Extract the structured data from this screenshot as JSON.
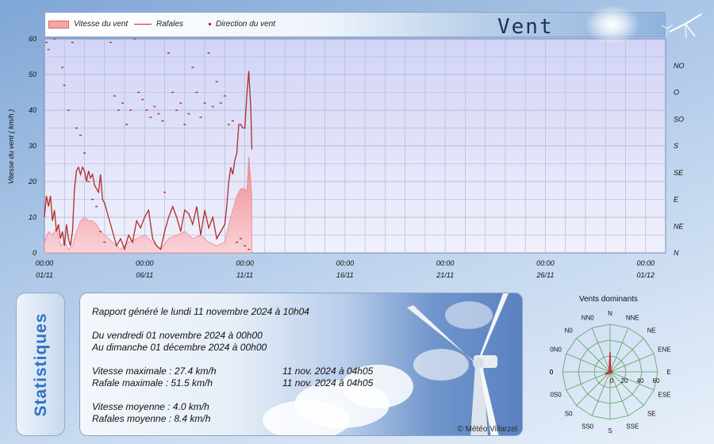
{
  "header": {
    "title": "Vent",
    "legend": {
      "speed_label": "Vitesse du vent",
      "gust_label": "Rafales",
      "direction_label": "Direction du vent"
    }
  },
  "colors": {
    "speed_fill": "#f3a7a7",
    "gust_line": "#b22b2b",
    "plot_bg_top": "#d4d6f7",
    "plot_bg_bottom": "#eef0fb",
    "rose_grid": "#59a05b",
    "rose_series": "#c0303a",
    "stat_label": "#2f72c2"
  },
  "chart_data": {
    "type": "line",
    "ylabel": "Vitesse du vent ( km/h )",
    "ylim": [
      0,
      60
    ],
    "yticks": [
      "0",
      "10",
      "20",
      "30",
      "40",
      "50",
      "60"
    ],
    "y2ticks": [
      "N",
      "NE",
      "E",
      "SE",
      "S",
      "SO",
      "O",
      "NO"
    ],
    "x_range_days": [
      1,
      32
    ],
    "xticks": [
      {
        "time": "00:00",
        "date": "01/11"
      },
      {
        "time": "00:00",
        "date": "06/11"
      },
      {
        "time": "00:00",
        "date": "11/11"
      },
      {
        "time": "00:00",
        "date": "16/11"
      },
      {
        "time": "00:00",
        "date": "21/11"
      },
      {
        "time": "00:00",
        "date": "26/11"
      },
      {
        "time": "00:00",
        "date": "01/12"
      }
    ],
    "grid": true,
    "legend_position": "top",
    "series": [
      {
        "name": "Rafales",
        "x": [
          1.0,
          1.1,
          1.2,
          1.3,
          1.4,
          1.5,
          1.6,
          1.7,
          1.8,
          1.9,
          2.0,
          2.1,
          2.2,
          2.3,
          2.4,
          2.5,
          2.6,
          2.7,
          2.8,
          2.9,
          3.0,
          3.1,
          3.2,
          3.3,
          3.4,
          3.5,
          3.6,
          3.7,
          3.8,
          3.9,
          4.0,
          4.2,
          4.4,
          4.6,
          4.8,
          5.0,
          5.2,
          5.4,
          5.6,
          5.8,
          6.0,
          6.2,
          6.4,
          6.6,
          6.8,
          7.0,
          7.2,
          7.4,
          7.6,
          7.8,
          8.0,
          8.2,
          8.4,
          8.6,
          8.8,
          9.0,
          9.2,
          9.4,
          9.6,
          9.8,
          10.0,
          10.1,
          10.2,
          10.3,
          10.4,
          10.5,
          10.6,
          10.7,
          10.8,
          10.9,
          11.0,
          11.1,
          11.2,
          11.3,
          11.35
        ],
        "values": [
          10,
          16,
          13,
          16,
          9,
          12,
          6,
          8,
          4,
          6,
          2,
          8,
          4,
          2,
          6,
          18,
          23,
          24,
          22,
          24,
          23,
          20,
          23,
          21,
          22,
          19,
          18,
          17,
          22,
          15,
          14,
          10,
          6,
          2,
          4,
          1,
          5,
          3,
          9,
          7,
          10,
          12,
          4,
          2,
          1,
          6,
          10,
          13,
          10,
          6,
          12,
          11,
          8,
          13,
          5,
          12,
          7,
          10,
          4,
          6,
          8,
          13,
          20,
          24,
          22,
          26,
          28,
          36,
          36,
          35,
          35,
          44,
          51,
          40,
          29
        ]
      },
      {
        "name": "Vitesse du vent",
        "x": [
          1.0,
          1.2,
          1.4,
          1.6,
          1.8,
          2.0,
          2.2,
          2.4,
          2.6,
          2.8,
          3.0,
          3.2,
          3.4,
          3.6,
          3.8,
          4.0,
          4.4,
          4.8,
          5.2,
          5.6,
          6.0,
          6.4,
          6.8,
          7.2,
          7.6,
          8.0,
          8.4,
          8.8,
          9.2,
          9.6,
          10.0,
          10.2,
          10.4,
          10.6,
          10.8,
          11.0,
          11.1,
          11.2,
          11.3,
          11.35
        ],
        "values": [
          3,
          6,
          5,
          7,
          2,
          3,
          1,
          2,
          6,
          9,
          10,
          9,
          9,
          8,
          6,
          5,
          3,
          1,
          3,
          4,
          5,
          3,
          1,
          4,
          5,
          6,
          4,
          5,
          3,
          2,
          3,
          8,
          12,
          16,
          18,
          18,
          17,
          27,
          20,
          16
        ]
      },
      {
        "name": "Direction du vent",
        "points": [
          [
            1.1,
            59
          ],
          [
            1.2,
            57
          ],
          [
            1.5,
            60
          ],
          [
            1.9,
            52
          ],
          [
            2.0,
            47
          ],
          [
            2.2,
            40
          ],
          [
            2.4,
            59
          ],
          [
            2.6,
            35
          ],
          [
            2.8,
            33
          ],
          [
            3.0,
            28
          ],
          [
            3.2,
            20
          ],
          [
            3.4,
            15
          ],
          [
            3.6,
            13
          ],
          [
            3.8,
            6
          ],
          [
            4.0,
            3
          ],
          [
            4.3,
            59
          ],
          [
            4.5,
            44
          ],
          [
            4.7,
            40
          ],
          [
            4.9,
            42
          ],
          [
            5.1,
            36
          ],
          [
            5.3,
            40
          ],
          [
            5.5,
            60
          ],
          [
            5.7,
            45
          ],
          [
            5.9,
            43
          ],
          [
            6.1,
            40
          ],
          [
            6.3,
            38
          ],
          [
            6.5,
            41
          ],
          [
            6.7,
            39
          ],
          [
            6.9,
            37
          ],
          [
            7.0,
            17
          ],
          [
            7.2,
            56
          ],
          [
            7.4,
            45
          ],
          [
            7.6,
            40
          ],
          [
            7.8,
            42
          ],
          [
            8.0,
            36
          ],
          [
            8.2,
            39
          ],
          [
            8.4,
            52
          ],
          [
            8.6,
            45
          ],
          [
            8.8,
            38
          ],
          [
            9.0,
            42
          ],
          [
            9.2,
            56
          ],
          [
            9.4,
            41
          ],
          [
            9.6,
            48
          ],
          [
            9.8,
            42
          ],
          [
            10.0,
            44
          ],
          [
            10.2,
            36
          ],
          [
            10.4,
            37
          ],
          [
            10.6,
            3
          ],
          [
            10.8,
            4
          ],
          [
            11.0,
            2
          ],
          [
            11.2,
            1
          ]
        ]
      }
    ]
  },
  "stats": {
    "tab_label": "Statistiques",
    "generated": "Rapport généré le lundi 11 novembre 2024 à 10h04",
    "period_from": "Du vendredi 01 novembre 2024 à 00h00",
    "period_to": "Au dimanche 01 décembre 2024 à 00h00",
    "max_speed": "Vitesse maximale : 27.4 km/h",
    "max_speed_date": "11 nov. 2024 à 04h05",
    "max_gust": "Rafale maximale : 51.5 km/h",
    "max_gust_date": "11 nov. 2024 à 04h05",
    "avg_speed": "Vitesse moyenne : 4.0 km/h",
    "avg_gust": "Rafales moyenne : 8.4 km/h",
    "copyright": "© Météo Villarzel"
  },
  "rose": {
    "title": "Vents dominants",
    "directions": [
      "N",
      "NNE",
      "NE",
      "ENE",
      "E",
      "ESE",
      "SE",
      "SSE",
      "S",
      "SS0",
      "S0",
      "0S0",
      "0",
      "0N0",
      "N0",
      "NN0"
    ],
    "values": [
      25,
      2,
      1,
      2,
      3,
      2,
      1,
      1,
      1,
      2,
      3,
      7,
      2,
      1,
      2,
      3
    ],
    "rings": [
      "20",
      "40",
      "60"
    ],
    "center_label": "0",
    "west_label": "0",
    "max": 60
  }
}
